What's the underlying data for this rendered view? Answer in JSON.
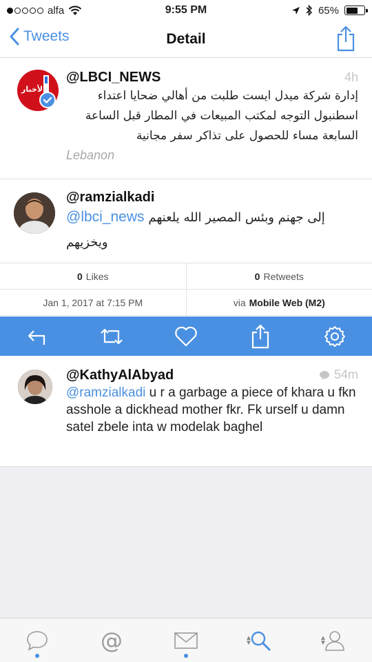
{
  "status_bar": {
    "carrier": "alfa",
    "time": "9:55 PM",
    "battery": "65%",
    "battery_level": 0.65
  },
  "nav": {
    "back_label": "Tweets",
    "title": "Detail"
  },
  "main_tweet": {
    "handle": "@LBCI_NEWS",
    "time": "4h",
    "text_line1": "إدارة شركة ميدل ايست طلبت من أهالي ضحايا اعتداء",
    "text_line2": "اسطنبول التوجه لمكتب المبيعات في المطار قبل الساعة",
    "text_line3": "السابعة مساء للحصول على تذاكر سفر مجانية",
    "location": "Lebanon",
    "avatar_label": "الأخبار",
    "verified": true
  },
  "detail_tweet": {
    "handle": "@ramzialkadi",
    "mention": "@lbci_news",
    "text_line1": "إلى جهنم وبئس المصير الله يلعنهم",
    "text_line2": "ويخزيهم",
    "likes_count": "0",
    "likes_label": "Likes",
    "retweets_count": "0",
    "retweets_label": "Retweets",
    "date": "Jan 1, 2017 at 7:15 PM",
    "via_prefix": "via",
    "via_client": "Mobile Web (M2)"
  },
  "actions": [
    {
      "icon": "reply-icon"
    },
    {
      "icon": "retweet-icon"
    },
    {
      "icon": "heart-icon"
    },
    {
      "icon": "share-icon"
    },
    {
      "icon": "gear-icon"
    }
  ],
  "reply": {
    "handle": "@KathyAlAbyad",
    "time": "54m",
    "mention": "@ramzialkadi",
    "text": " u r a garbage a piece of khara u fkn asshole a dickhead mother fkr. Fk urself u damn satel zbele inta w modelak baghel"
  },
  "tab_bar": [
    {
      "icon": "timeline-icon",
      "active_dot": true
    },
    {
      "icon": "mentions-icon",
      "active_dot": false
    },
    {
      "icon": "messages-icon",
      "active_dot": true
    },
    {
      "icon": "search-icon",
      "active_dot": false
    },
    {
      "icon": "profile-icon",
      "active_dot": false
    }
  ],
  "colors": {
    "accent": "#4a90e2",
    "muted": "#c6c6c6",
    "background_empty": "#efeff4"
  }
}
